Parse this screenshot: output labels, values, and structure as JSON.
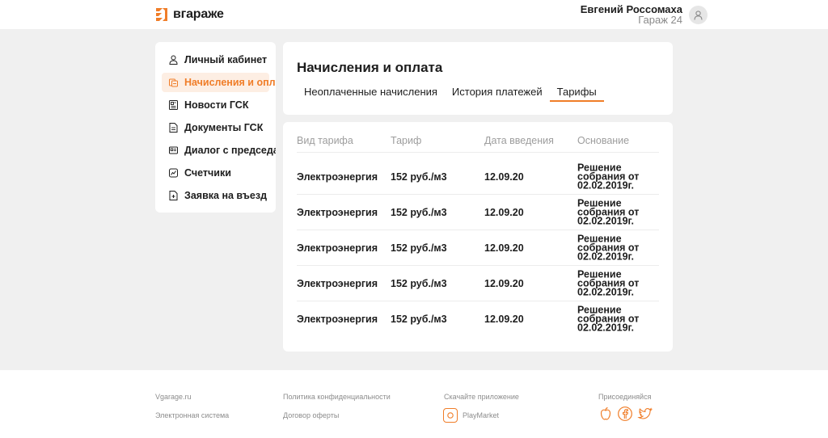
{
  "header": {
    "logo_text": "вгараже",
    "user_name": "Евгений Россомаха",
    "user_garage": "Гараж 24",
    "accent": "#f07d28"
  },
  "sidebar": {
    "items": [
      {
        "label": "Личный кабинет",
        "icon": "user-icon"
      },
      {
        "label": "Начисления и оплата",
        "icon": "coins-icon",
        "active": true
      },
      {
        "label": "Новости ГСК",
        "icon": "news-icon"
      },
      {
        "label": "Документы ГСК",
        "icon": "document-icon"
      },
      {
        "label": "Диалог с председателем",
        "icon": "chat-card-icon"
      },
      {
        "label": "Счетчики",
        "icon": "meter-icon"
      },
      {
        "label": "Заявка на въезд",
        "icon": "entry-request-icon"
      }
    ]
  },
  "main": {
    "title": "Начисления и оплата",
    "tabs": [
      {
        "label": "Неоплаченные начисления"
      },
      {
        "label": "История платежей"
      },
      {
        "label": "Тарифы",
        "active": true
      }
    ],
    "table": {
      "headers": [
        "Вид тарифа",
        "Тариф",
        "Дата введения",
        "Основание"
      ],
      "rows": [
        {
          "type": "Электроэнергия",
          "rate": "152 руб./м3",
          "date": "12.09.20",
          "basis": "Решение собрания от 02.02.2019г."
        },
        {
          "type": "Электроэнергия",
          "rate": "152 руб./м3",
          "date": "12.09.20",
          "basis": "Решение собрания от 02.02.2019г."
        },
        {
          "type": "Электроэнергия",
          "rate": "152 руб./м3",
          "date": "12.09.20",
          "basis": "Решение собрания от 02.02.2019г."
        },
        {
          "type": "Электроэнергия",
          "rate": "152 руб./м3",
          "date": "12.09.20",
          "basis": "Решение собрания от 02.02.2019г."
        },
        {
          "type": "Электроэнергия",
          "rate": "152 руб./м3",
          "date": "12.09.20",
          "basis": "Решение собрания от 02.02.2019г."
        }
      ]
    }
  },
  "footer": {
    "site": "Vgarage.ru",
    "system": "Электронная система",
    "privacy": "Политика конфиденциальности",
    "offer": "Договор оферты",
    "app_label": "Скачайте приложение",
    "playmarket": "PlayMarket",
    "join_label": "Присоединяйся",
    "social_icons": [
      "apple-icon",
      "facebook-icon",
      "twitter-icon"
    ]
  }
}
